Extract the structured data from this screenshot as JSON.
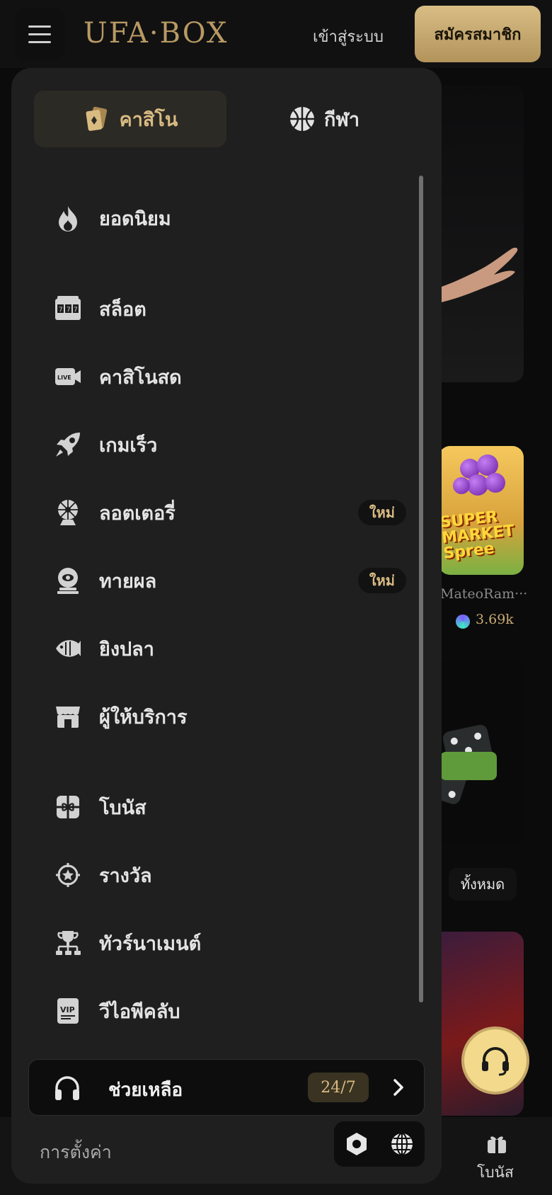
{
  "header": {
    "logo": "UFA·BOX",
    "login_label": "เข้าสู่ระบบ",
    "signup_label": "สมัครสมาชิก"
  },
  "drawer": {
    "tabs": [
      {
        "label": "คาสิโน",
        "icon": "playing-cards-icon",
        "active": true
      },
      {
        "label": "กีฬา",
        "icon": "basketball-icon",
        "active": false
      }
    ],
    "menu": [
      {
        "label": "ยอดนิยม",
        "icon": "flame-icon"
      },
      {
        "label": "สล็อต",
        "icon": "slot-machine-icon"
      },
      {
        "label": "คาสิโนสด",
        "icon": "live-camera-icon"
      },
      {
        "label": "เกมเร็ว",
        "icon": "rocket-icon"
      },
      {
        "label": "ลอตเตอรี่",
        "icon": "lottery-wheel-icon",
        "badge": "ใหม่"
      },
      {
        "label": "ทายผล",
        "icon": "crystal-ball-icon",
        "badge": "ใหม่"
      },
      {
        "label": "ยิงปลา",
        "icon": "fish-icon"
      },
      {
        "label": "ผู้ให้บริการ",
        "icon": "storefront-icon"
      },
      {
        "label": "โบนัส",
        "icon": "gift-icon"
      },
      {
        "label": "รางวัล",
        "icon": "reward-star-icon"
      },
      {
        "label": "ทัวร์นาเมนต์",
        "icon": "trophy-icon"
      },
      {
        "label": "วีไอพีคลับ",
        "icon": "vip-card-icon"
      }
    ],
    "help": {
      "label": "ช่วยเหลือ",
      "badge": "24/7"
    },
    "settings_label": "การตั้งค่า"
  },
  "background": {
    "game_title": "SUPER MARKET Spree",
    "player_name": "MateoRam···",
    "amount": "3.69k",
    "see_all_label": "ทั้งหมด",
    "bottom_nav_label": "โบนัส"
  },
  "colors": {
    "accent_gold": "#d9bb82",
    "signup_gold": "#c9a86b",
    "drawer_bg": "#1f1f20",
    "page_bg": "#0b0b0c"
  }
}
